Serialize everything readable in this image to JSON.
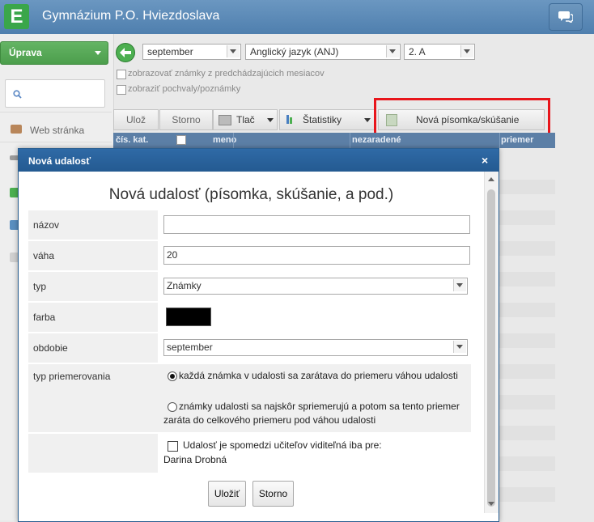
{
  "app": {
    "title": "Gymnázium P.O. Hviezdoslava",
    "logo_letter": "E",
    "brand_color": "#4f7fae"
  },
  "sidebar": {
    "menu_button": "Úprava",
    "search_placeholder": "",
    "items": [
      {
        "label": "Web stránka",
        "icon": "home-icon"
      }
    ]
  },
  "filters": {
    "month": "september",
    "subject": "Anglický jazyk (ANJ)",
    "class": "2. A",
    "checkbox_prev_months": "zobrazovať známky z predchádzajúcich mesiacov",
    "checkbox_praise": "zobraziť pochvaly/poznámky"
  },
  "toolbar": {
    "save": "Ulož",
    "cancel": "Storno",
    "print": "Tlač",
    "stats": "Štatistiky",
    "new_exam": "Nová písomka/skúšanie"
  },
  "grid": {
    "columns": [
      "čís. kat.",
      "",
      "meno",
      "nezaradené",
      "priemer"
    ]
  },
  "modal": {
    "title": "Nová udalosť",
    "close": "×",
    "heading": "Nová udalosť (písomka, skúšanie, a pod.)",
    "fields": {
      "name_label": "názov",
      "name_value": "",
      "weight_label": "váha",
      "weight_value": "20",
      "type_label": "typ",
      "type_value": "Známky",
      "color_label": "farba",
      "color_value": "#000000",
      "period_label": "obdobie",
      "period_value": "september",
      "averaging_label": "typ priemerovania",
      "averaging_option1": "každá známka v udalosti sa zarátava do priemeru váhou udalosti",
      "averaging_option2": "známky udalosti sa najskôr spriemerujú a potom sa tento priemer zaráta do celkového priemeru pod váhou udalosti",
      "averaging_selected": 1,
      "visibility_label": "Udalosť je spomedzi učiteľov viditeľná iba pre:",
      "visibility_user": "Darina Drobná"
    },
    "buttons": {
      "save": "Uložiť",
      "cancel": "Storno"
    }
  }
}
